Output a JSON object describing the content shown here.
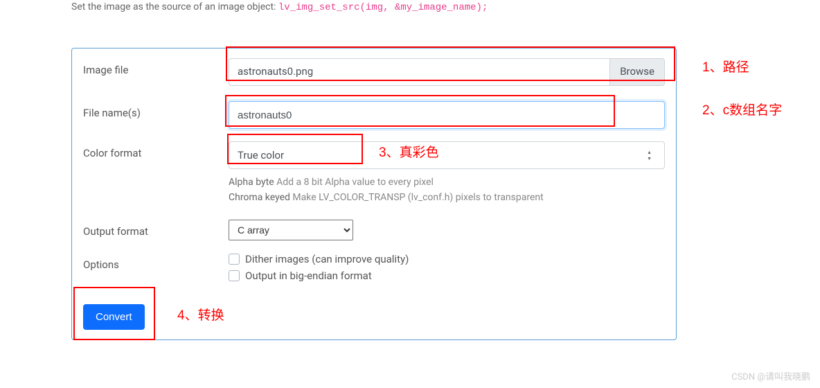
{
  "top_text_prefix": "Set the image as the source of an image object: ",
  "top_text_code": "lv_img_set_src(img, &my_image_name);",
  "labels": {
    "image_file": "Image file",
    "file_names": "File name(s)",
    "color_format": "Color format",
    "output_format": "Output format",
    "options": "Options"
  },
  "image_file": {
    "value": "astronauts0.png",
    "browse": "Browse"
  },
  "file_name": "astronauts0",
  "color_format": {
    "value": "True color",
    "helper1_a": "Alpha byte ",
    "helper1_b": "Add a 8 bit Alpha value to every pixel",
    "helper2_a": "Chroma keyed ",
    "helper2_b": "Make LV_COLOR_TRANSP (lv_conf.h) pixels to transparent"
  },
  "output_format": "C array",
  "options": {
    "dither": "Dither images (can improve quality)",
    "bigendian": "Output in big-endian format"
  },
  "convert": "Convert",
  "annotations": {
    "a1": "1、路径",
    "a2": "2、c数组名字",
    "a3": "3、真彩色",
    "a4": "4、转换"
  },
  "watermark": "CSDN @请叫我晓鹏"
}
